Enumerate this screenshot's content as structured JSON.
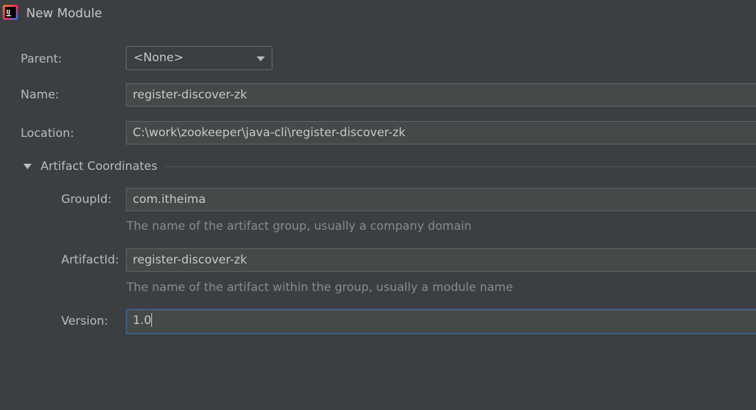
{
  "window": {
    "title": "New Module",
    "app_icon": "intellij-idea-icon",
    "accent_focus_color": "#3d6185"
  },
  "form": {
    "parent": {
      "label": "Parent:",
      "selected": "<None>"
    },
    "name": {
      "label": "Name:",
      "value": "register-discover-zk"
    },
    "location": {
      "label": "Location:",
      "value": "C:\\work\\zookeeper\\java-cli\\register-discover-zk"
    }
  },
  "artifact": {
    "section_title": "Artifact Coordinates",
    "expanded": true,
    "group_id": {
      "label": "GroupId:",
      "value": "com.itheima",
      "hint": "The name of the artifact group, usually a company domain"
    },
    "artifact_id": {
      "label": "ArtifactId:",
      "value": "register-discover-zk",
      "hint": "The name of the artifact within the group, usually a module name"
    },
    "version": {
      "label": "Version:",
      "value": "1.0"
    }
  }
}
